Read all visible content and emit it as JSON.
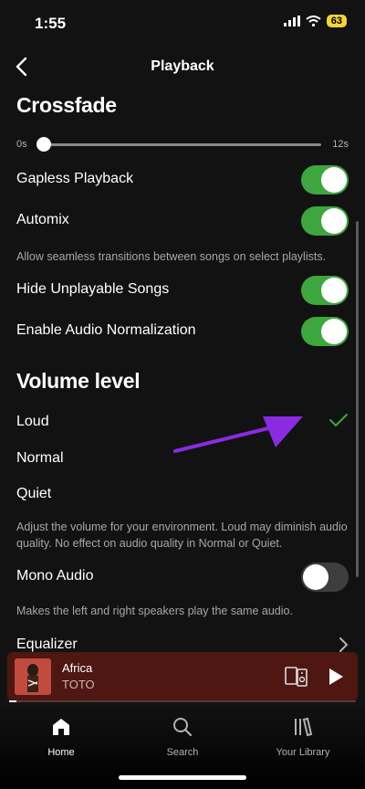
{
  "status_bar": {
    "time": "1:55",
    "battery": "63"
  },
  "header": {
    "title": "Playback"
  },
  "crossfade": {
    "heading": "Crossfade",
    "min_label": "0s",
    "max_label": "12s",
    "value_seconds": 0
  },
  "toggles": [
    {
      "label": "Gapless Playback",
      "on": true
    },
    {
      "label": "Automix",
      "on": true
    },
    {
      "label": "Hide Unplayable Songs",
      "on": true
    },
    {
      "label": "Enable Audio Normalization",
      "on": true
    }
  ],
  "automix_description": "Allow seamless transitions between songs on select playlists.",
  "volume_level": {
    "heading": "Volume level",
    "options": [
      "Loud",
      "Normal",
      "Quiet"
    ],
    "selected": "Loud",
    "description": "Adjust the volume for your environment. Loud may diminish audio quality. No effect on audio quality in Normal or Quiet."
  },
  "mono_audio": {
    "label": "Mono Audio",
    "on": false,
    "description": "Makes the left and right speakers play the same audio."
  },
  "equalizer": {
    "label": "Equalizer"
  },
  "now_playing": {
    "title": "Africa",
    "artist": "TOTO",
    "progress": 0.02
  },
  "tabs": [
    {
      "label": "Home",
      "icon": "home-icon",
      "active": true
    },
    {
      "label": "Search",
      "icon": "search-icon",
      "active": false
    },
    {
      "label": "Your Library",
      "icon": "library-icon",
      "active": false
    }
  ],
  "colors": {
    "accent_green": "#3ea63e",
    "annotation_arrow": "#8a2be2",
    "player_bg": "#4e1712"
  }
}
